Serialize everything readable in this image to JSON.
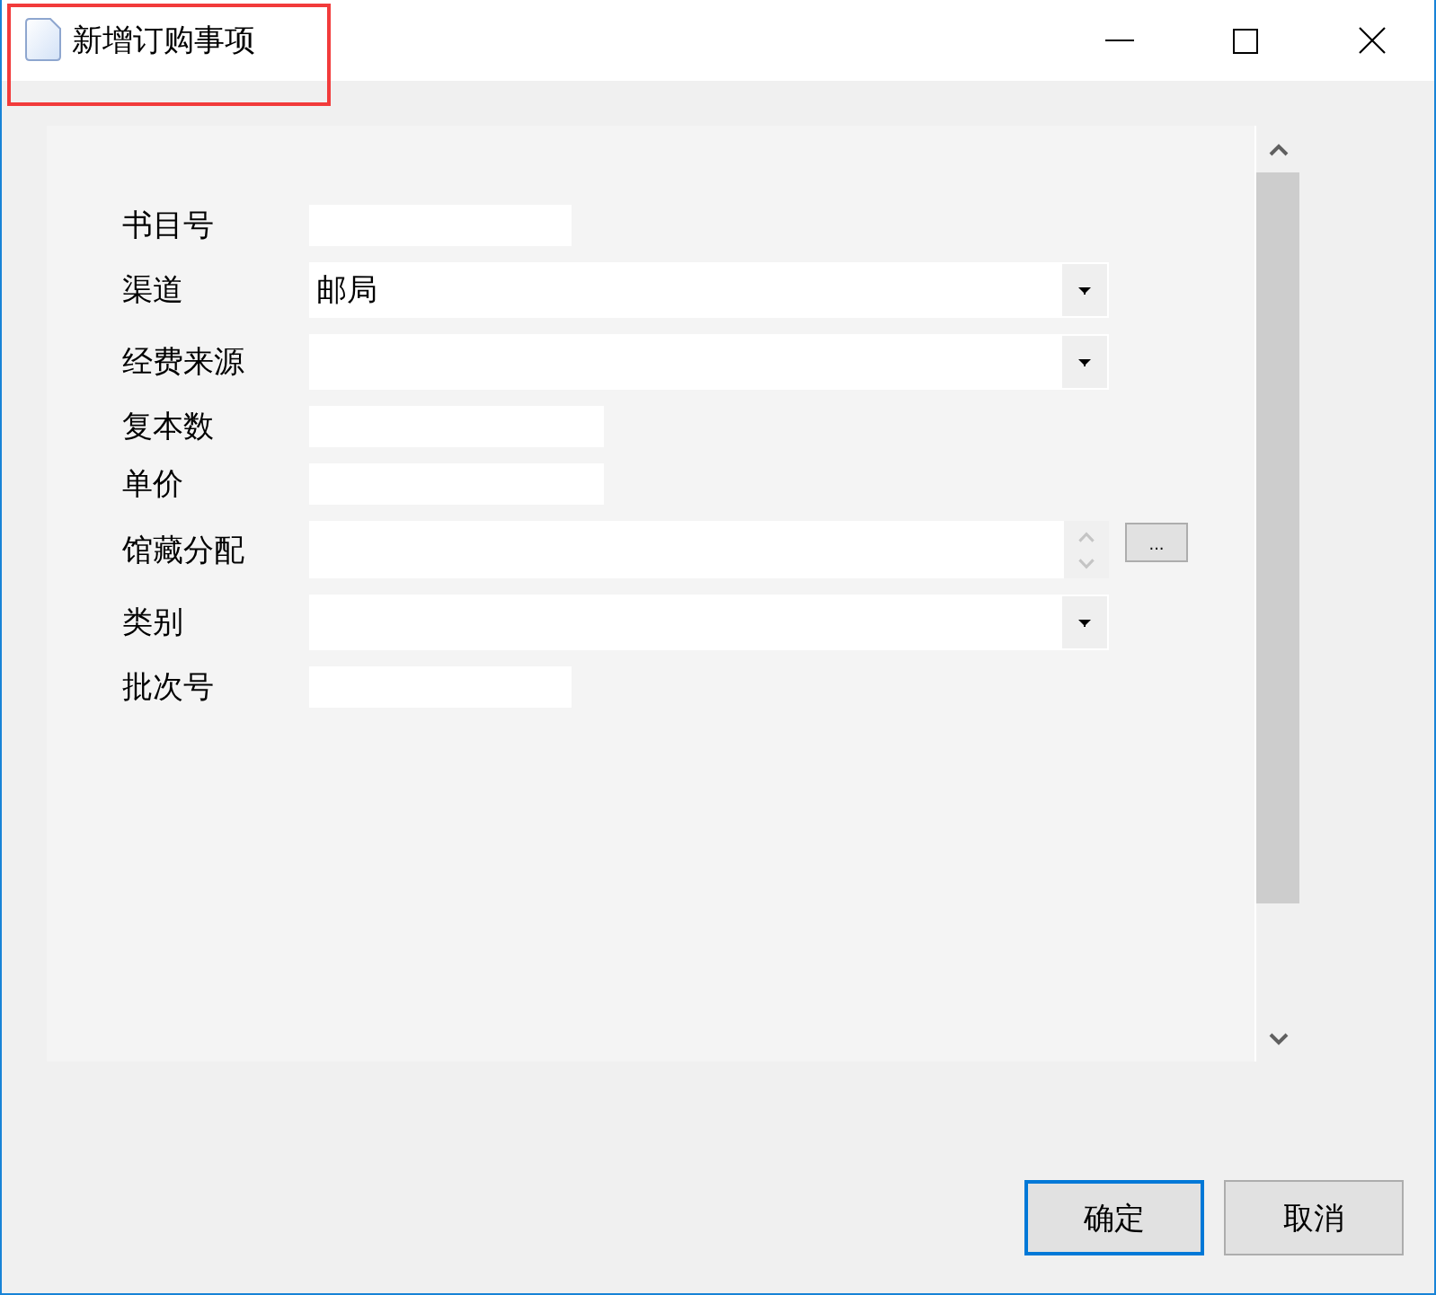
{
  "window": {
    "title": "新增订购事项"
  },
  "form": {
    "fields": [
      {
        "label": "书目号",
        "kind": "text"
      },
      {
        "label": "渠道",
        "kind": "combo",
        "value": "邮局"
      },
      {
        "label": "经费来源",
        "kind": "combo"
      },
      {
        "label": "复本数",
        "kind": "text"
      },
      {
        "label": "单价",
        "kind": "text"
      },
      {
        "label": "馆藏分配",
        "kind": "spin",
        "button": "..."
      },
      {
        "label": "类别",
        "kind": "combo"
      },
      {
        "label": "批次号",
        "kind": "text"
      }
    ]
  },
  "buttons": [
    {
      "label": "确定",
      "focused": true
    },
    {
      "label": "取消",
      "focused": false
    }
  ]
}
